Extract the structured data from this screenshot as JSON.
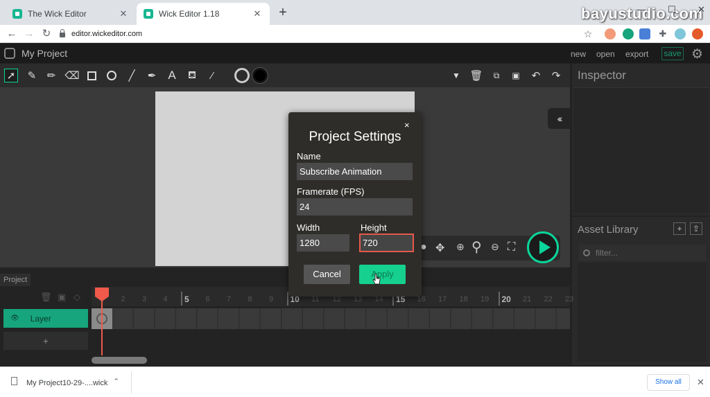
{
  "browser": {
    "tabs": [
      {
        "title": "The Wick Editor",
        "active": false
      },
      {
        "title": "Wick Editor 1.18",
        "active": true
      }
    ],
    "new_tab": "+",
    "watermark": "bayustudio.com",
    "url": "editor.wickeditor.com"
  },
  "app": {
    "title": "My Project",
    "menu": {
      "new": "new",
      "open": "open",
      "export": "export",
      "save": "save"
    }
  },
  "inspector": {
    "title": "Inspector"
  },
  "asset_library": {
    "title": "Asset Library",
    "filter_placeholder": "filter..."
  },
  "timeline": {
    "tab": "Project",
    "layer_name": "Layer",
    "add_layer": "+",
    "frame_numbers": [
      "1",
      "2",
      "3",
      "4",
      "5",
      "6",
      "7",
      "8",
      "9",
      "10",
      "11",
      "12",
      "13",
      "14",
      "15",
      "16",
      "17",
      "18",
      "19",
      "20",
      "21",
      "22",
      "23"
    ]
  },
  "modal": {
    "title": "Project Settings",
    "close": "×",
    "name_label": "Name",
    "name_value": "Subscribe Animation",
    "framerate_label": "Framerate (FPS)",
    "framerate_value": "24",
    "width_label": "Width",
    "width_value": "1280",
    "height_label": "Height",
    "height_value": "720",
    "cancel": "Cancel",
    "apply": "Apply"
  },
  "downloads": {
    "file": "My Project10-29-....wick",
    "show_all": "Show all"
  },
  "colors": {
    "accent": "#0bd59a",
    "playhead": "#f05a4a",
    "layer": "#16a57c"
  }
}
